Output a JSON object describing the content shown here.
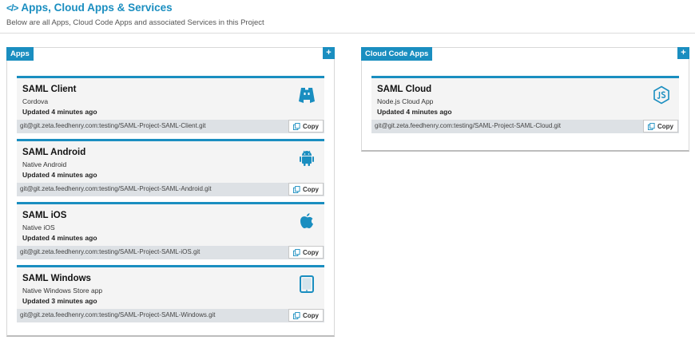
{
  "header": {
    "title": "Apps, Cloud Apps & Services",
    "subtitle": "Below are all Apps, Cloud Code Apps and associated Services in this Project"
  },
  "apps_panel": {
    "label": "Apps",
    "add_label": "+",
    "cards": [
      {
        "title": "SAML Client",
        "type": "Cordova",
        "updated": "Updated 4 minutes ago",
        "git": "git@git.zeta.feedhenry.com:testing/SAML-Project-SAML-Client.git",
        "copy": "Copy",
        "icon": "cordova-icon"
      },
      {
        "title": "SAML Android",
        "type": "Native Android",
        "updated": "Updated 4 minutes ago",
        "git": "git@git.zeta.feedhenry.com:testing/SAML-Project-SAML-Android.git",
        "copy": "Copy",
        "icon": "android-icon"
      },
      {
        "title": "SAML iOS",
        "type": "Native iOS",
        "updated": "Updated 4 minutes ago",
        "git": "git@git.zeta.feedhenry.com:testing/SAML-Project-SAML-iOS.git",
        "copy": "Copy",
        "icon": "apple-icon"
      },
      {
        "title": "SAML Windows",
        "type": "Native Windows Store app",
        "updated": "Updated 3 minutes ago",
        "git": "git@git.zeta.feedhenry.com:testing/SAML-Project-SAML-Windows.git",
        "copy": "Copy",
        "icon": "tablet-icon"
      }
    ]
  },
  "cloud_panel": {
    "label": "Cloud Code Apps",
    "add_label": "+",
    "cards": [
      {
        "title": "SAML Cloud",
        "type": "Node.js Cloud App",
        "updated": "Updated 4 minutes ago",
        "git": "git@git.zeta.feedhenry.com:testing/SAML-Project-SAML-Cloud.git",
        "copy": "Copy",
        "icon": "nodejs-icon"
      }
    ]
  },
  "colors": {
    "accent": "#1a8ec0"
  }
}
